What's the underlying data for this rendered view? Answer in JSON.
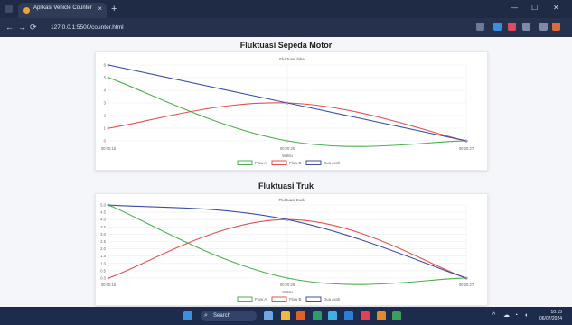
{
  "browser": {
    "tab_title": "Aplikasi Vehicle Counter",
    "tab_close": "×",
    "new_tab": "+",
    "url": "127.0.0.1:5500/counter.html",
    "nav_back": "←",
    "nav_forward": "→",
    "nav_reload": "⟳",
    "minimize": "—",
    "maximize": "☐",
    "close": "✕"
  },
  "charts": [
    {
      "section_title": "Fluktuasi Sepeda Motor",
      "chart_title": "Fluktuasi bike",
      "xlabel": "Waktu",
      "x_ticks": [
        "00:00:16",
        "00:00:25",
        "00:00:27"
      ],
      "y_ticks": [
        "0",
        "1",
        "2",
        "3",
        "4",
        "5",
        "6"
      ]
    },
    {
      "section_title": "Fluktuasi Truk",
      "chart_title": "Fluktuasi truck",
      "xlabel": "Waktu",
      "x_ticks": [
        "00:00:16",
        "00:00:26",
        "00:00:27"
      ],
      "y_ticks": [
        "0.0",
        "0.5",
        "1.0",
        "1.5",
        "2.0",
        "2.5",
        "3.0",
        "3.5",
        "4.0",
        "4.5",
        "5.0"
      ]
    }
  ],
  "chart_data": [
    {
      "type": "line",
      "title": "Fluktuasi bike",
      "xlabel": "Waktu",
      "ylabel": "",
      "categories": [
        "00:00:16",
        "00:00:25",
        "00:00:27"
      ],
      "ylim": [
        0,
        6
      ],
      "grid": true,
      "legend": "bottom",
      "series": [
        {
          "name": "Flow A",
          "values": [
            5,
            0,
            0
          ],
          "color": "#4caf50"
        },
        {
          "name": "Flow B",
          "values": [
            1,
            3,
            0
          ],
          "color": "#e05252"
        },
        {
          "name": "Dua Arah",
          "values": [
            6,
            3,
            0
          ],
          "color": "#3c4fa8"
        }
      ]
    },
    {
      "type": "line",
      "title": "Fluktuasi truck",
      "xlabel": "Waktu",
      "ylabel": "",
      "categories": [
        "00:00:16",
        "00:00:26",
        "00:00:27"
      ],
      "ylim": [
        0,
        5
      ],
      "grid": true,
      "legend": "bottom",
      "series": [
        {
          "name": "Flow A",
          "values": [
            5,
            0,
            0
          ],
          "color": "#4caf50"
        },
        {
          "name": "Flow B",
          "values": [
            0,
            4,
            0
          ],
          "color": "#e05252"
        },
        {
          "name": "Dua Arah",
          "values": [
            5,
            4,
            0
          ],
          "color": "#3c4fa8"
        }
      ]
    }
  ],
  "taskbar": {
    "search_label": "Search",
    "search_icon": "search-icon",
    "clock_time": "10:15",
    "clock_date": "06/07/2024"
  },
  "colors": {
    "flow_a": "#4caf50",
    "flow_b": "#e05252",
    "dua_arah": "#3c4fa8",
    "titlebar": "#1f2a44",
    "taskbar": "#1d2b4c"
  }
}
